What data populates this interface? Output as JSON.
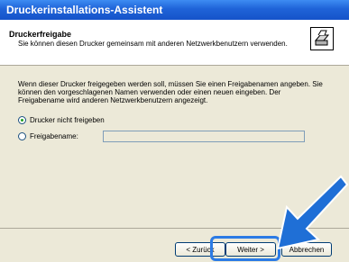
{
  "window": {
    "title": "Druckerinstallations-Assistent"
  },
  "header": {
    "title": "Druckerfreigabe",
    "subtitle": "Sie können diesen Drucker gemeinsam mit anderen Netzwerkbenutzern verwenden."
  },
  "main": {
    "description": "Wenn dieser Drucker freigegeben werden soll, müssen Sie einen Freigabenamen angeben. Sie können den vorgeschlagenen Namen verwenden oder einen neuen eingeben. Der Freigabename wird anderen Netzwerkbenutzern angezeigt.",
    "options": [
      {
        "label": "Drucker nicht freigeben",
        "selected": true
      },
      {
        "label": "Freigabename:",
        "selected": false
      }
    ],
    "share_name_value": ""
  },
  "buttons": {
    "back": "< Zurück",
    "next": "Weiter >",
    "cancel": "Abbrechen"
  },
  "colors": {
    "titlebar": "#1f63d8",
    "highlight": "#2c7be5",
    "arrow": "#1f6fd6"
  }
}
